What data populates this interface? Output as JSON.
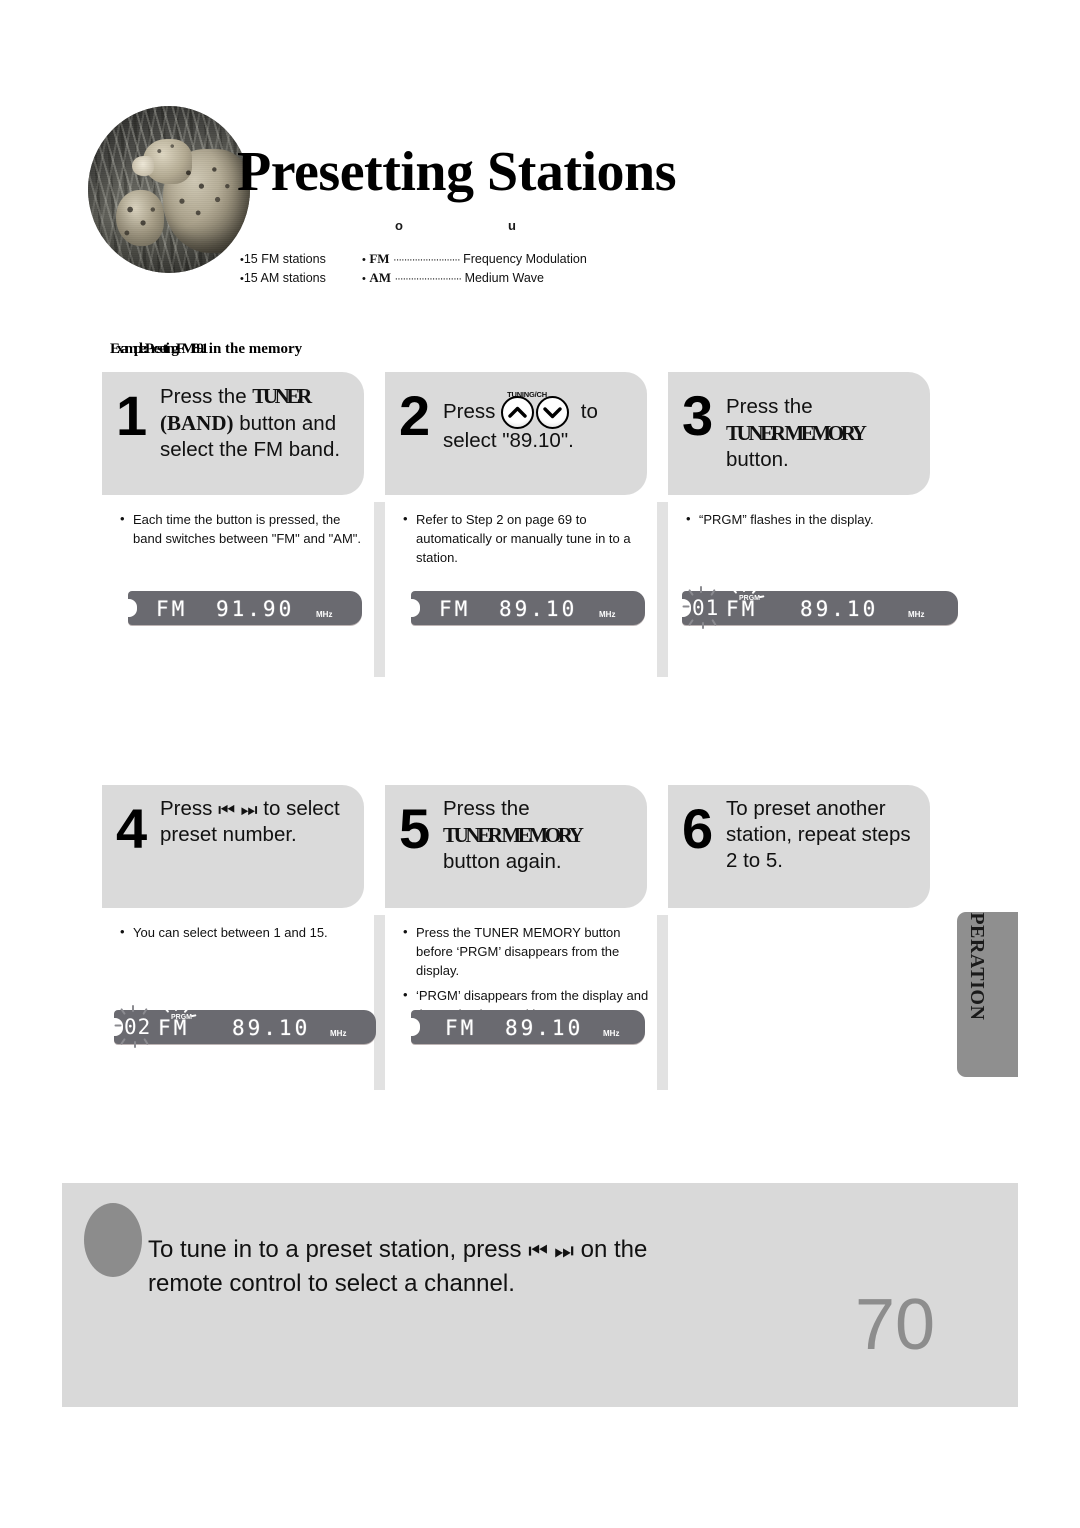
{
  "page": {
    "title": "Presetting Stations",
    "number": "70",
    "side_tab": "RADIO OPERATION"
  },
  "header": {
    "column_markers": {
      "left": "o",
      "right": "u"
    },
    "capacity": [
      {
        "bullet": "•",
        "text": "15 FM stations"
      },
      {
        "bullet": "•",
        "text": "15 AM stations"
      }
    ],
    "glossary": [
      {
        "bullet": "•",
        "term": "FM",
        "dots": "·························",
        "definition": "Frequency Modulation"
      },
      {
        "bullet": "•",
        "term": "AM",
        "dots": "·························",
        "definition": "Medium Wave"
      }
    ]
  },
  "example": {
    "prefix": "Example: Presetting FM ",
    "frequency": "89.1",
    "suffix": " in the memory"
  },
  "steps": [
    {
      "number": "1",
      "text_before": "Press the ",
      "emphasis": "TUNER",
      "emphasis_2": "(BAND)",
      "text_after": " button  and select the FM band.",
      "notes": [
        "Each time the button is pressed, the band switches between \"FM\" and \"AM\"."
      ],
      "display": {
        "band": "FM",
        "frequency": "91.90",
        "unit": "MHz",
        "preset": "",
        "prgm": ""
      }
    },
    {
      "number": "2",
      "text_before": "Press ",
      "button_label": "TUNING/CH",
      "text_after": " to select \"89.10\".",
      "notes": [
        "Refer to Step 2 on page 69 to automatically or manually tune in to a station."
      ],
      "display": {
        "band": "FM",
        "frequency": "89.10",
        "unit": "MHz",
        "preset": "",
        "prgm": ""
      }
    },
    {
      "number": "3",
      "text_before": "Press the ",
      "emphasis": "TUNER MEMORY",
      "text_after": " button.",
      "notes": [
        "“PRGM” flashes in the display."
      ],
      "display": {
        "band": "FM",
        "frequency": "89.10",
        "unit": "MHz",
        "preset": "01",
        "prgm": "PRGM"
      }
    },
    {
      "number": "4",
      "text_before": "Press ",
      "icons": "⏮ ⏭",
      "text_after": " to select preset number.",
      "notes": [
        "You can select between 1 and 15."
      ],
      "display": {
        "band": "FM",
        "frequency": "89.10",
        "unit": "MHz",
        "preset": "02",
        "prgm": "PRGM"
      }
    },
    {
      "number": "5",
      "text_before": "Press the ",
      "emphasis": "TUNER MEMORY",
      "text_after": " button again.",
      "notes": [
        "Press the TUNER MEMORY button before ‘PRGM’ disappears from the display.",
        "‘PRGM’ disappears from the display and the station is stored in memory."
      ],
      "display": {
        "band": "FM",
        "frequency": "89.10",
        "unit": "MHz",
        "preset": "",
        "prgm": ""
      }
    },
    {
      "number": "6",
      "text_before": "To preset another station, repeat steps 2 to 5.",
      "notes": [],
      "display": null
    }
  ],
  "footer": {
    "line_1_before": "To tune in to a preset station, press ",
    "line_1_icons": "⏮ ⏭",
    "line_1_after": " on the",
    "line_2": "remote control to select a channel."
  },
  "colors": {
    "card_gray": "#dadada",
    "footer_gray": "#d9d9d9",
    "tab_gray": "#8f8f8f",
    "lcd_gray": "#6a6a70",
    "page_number_gray": "#8d8d8d"
  }
}
